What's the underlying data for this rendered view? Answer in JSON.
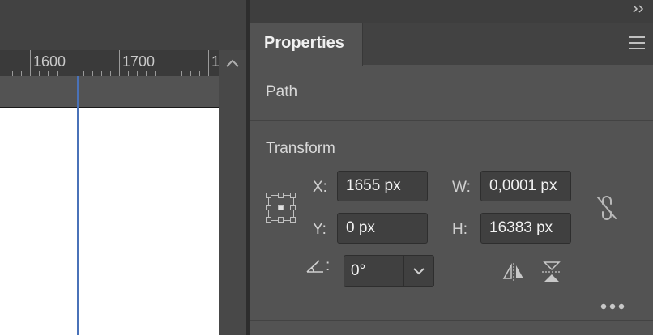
{
  "ruler": {
    "labels": [
      "1600",
      "1700",
      "1"
    ]
  },
  "panel": {
    "tab_title": "Properties",
    "section_path": "Path",
    "section_transform": "Transform",
    "x_label": "X:",
    "x_value": "1655 px",
    "y_label": "Y:",
    "y_value": "0 px",
    "w_label": "W:",
    "w_value": "0,0001 px",
    "h_label": "H:",
    "h_value": "16383 px",
    "angle_label": ":",
    "angle_value": "0°"
  },
  "colors": {
    "guide": "#4a72b8",
    "panel_bg": "#535353"
  }
}
